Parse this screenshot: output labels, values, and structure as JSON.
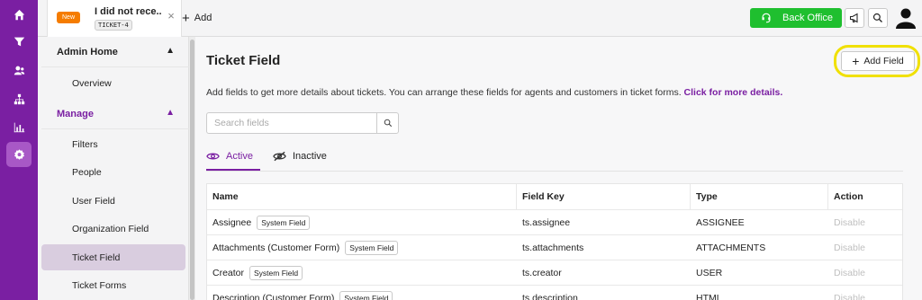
{
  "rail": {
    "items": [
      {
        "icon": "home-icon"
      },
      {
        "icon": "filter-icon"
      },
      {
        "icon": "people-icon"
      },
      {
        "icon": "org-chart-icon"
      },
      {
        "icon": "bar-chart-icon"
      },
      {
        "icon": "settings-icon",
        "active": true
      }
    ]
  },
  "topbar": {
    "tab": {
      "badge": "New",
      "title": "I did not rece...",
      "ticket_id": "TICKET-4",
      "close": "×"
    },
    "add_label": "Add",
    "back_office_label": "Back Office"
  },
  "sidebar": {
    "sections": [
      {
        "label": "Admin Home",
        "chevron": "▲"
      },
      {
        "label": "Manage",
        "chevron": "▲"
      }
    ],
    "items": [
      {
        "label": "Overview"
      },
      {
        "label": "Filters"
      },
      {
        "label": "People"
      },
      {
        "label": "User Field"
      },
      {
        "label": "Organization Field"
      },
      {
        "label": "Ticket Field",
        "active": true
      },
      {
        "label": "Ticket Forms"
      }
    ]
  },
  "main": {
    "title": "Ticket Field",
    "add_field_label": "Add Field",
    "description": "Add fields to get more details about tickets. You can arrange these fields for agents and customers in ticket forms.",
    "details_link": "Click for more details.",
    "search_placeholder": "Search fields",
    "tabs": [
      {
        "label": "Active",
        "active": true
      },
      {
        "label": "Inactive"
      }
    ],
    "table": {
      "headers": [
        "Name",
        "Field Key",
        "Type",
        "Action"
      ],
      "rows": [
        {
          "name": "Assignee",
          "tag": "System Field",
          "key": "ts.assignee",
          "type": "ASSIGNEE",
          "action": "Disable"
        },
        {
          "name": "Attachments (Customer Form)",
          "tag": "System Field",
          "key": "ts.attachments",
          "type": "ATTACHMENTS",
          "action": "Disable"
        },
        {
          "name": "Creator",
          "tag": "System Field",
          "key": "ts.creator",
          "type": "USER",
          "action": "Disable"
        },
        {
          "name": "Description (Customer Form)",
          "tag": "System Field",
          "key": "ts.description",
          "type": "HTML",
          "action": "Disable"
        }
      ]
    }
  },
  "colors": {
    "rail": "#7a1fa2",
    "accent": "#7a1fa2",
    "back_office": "#1fbf2f",
    "new_badge": "#f57c00",
    "highlight": "#f0e000"
  }
}
